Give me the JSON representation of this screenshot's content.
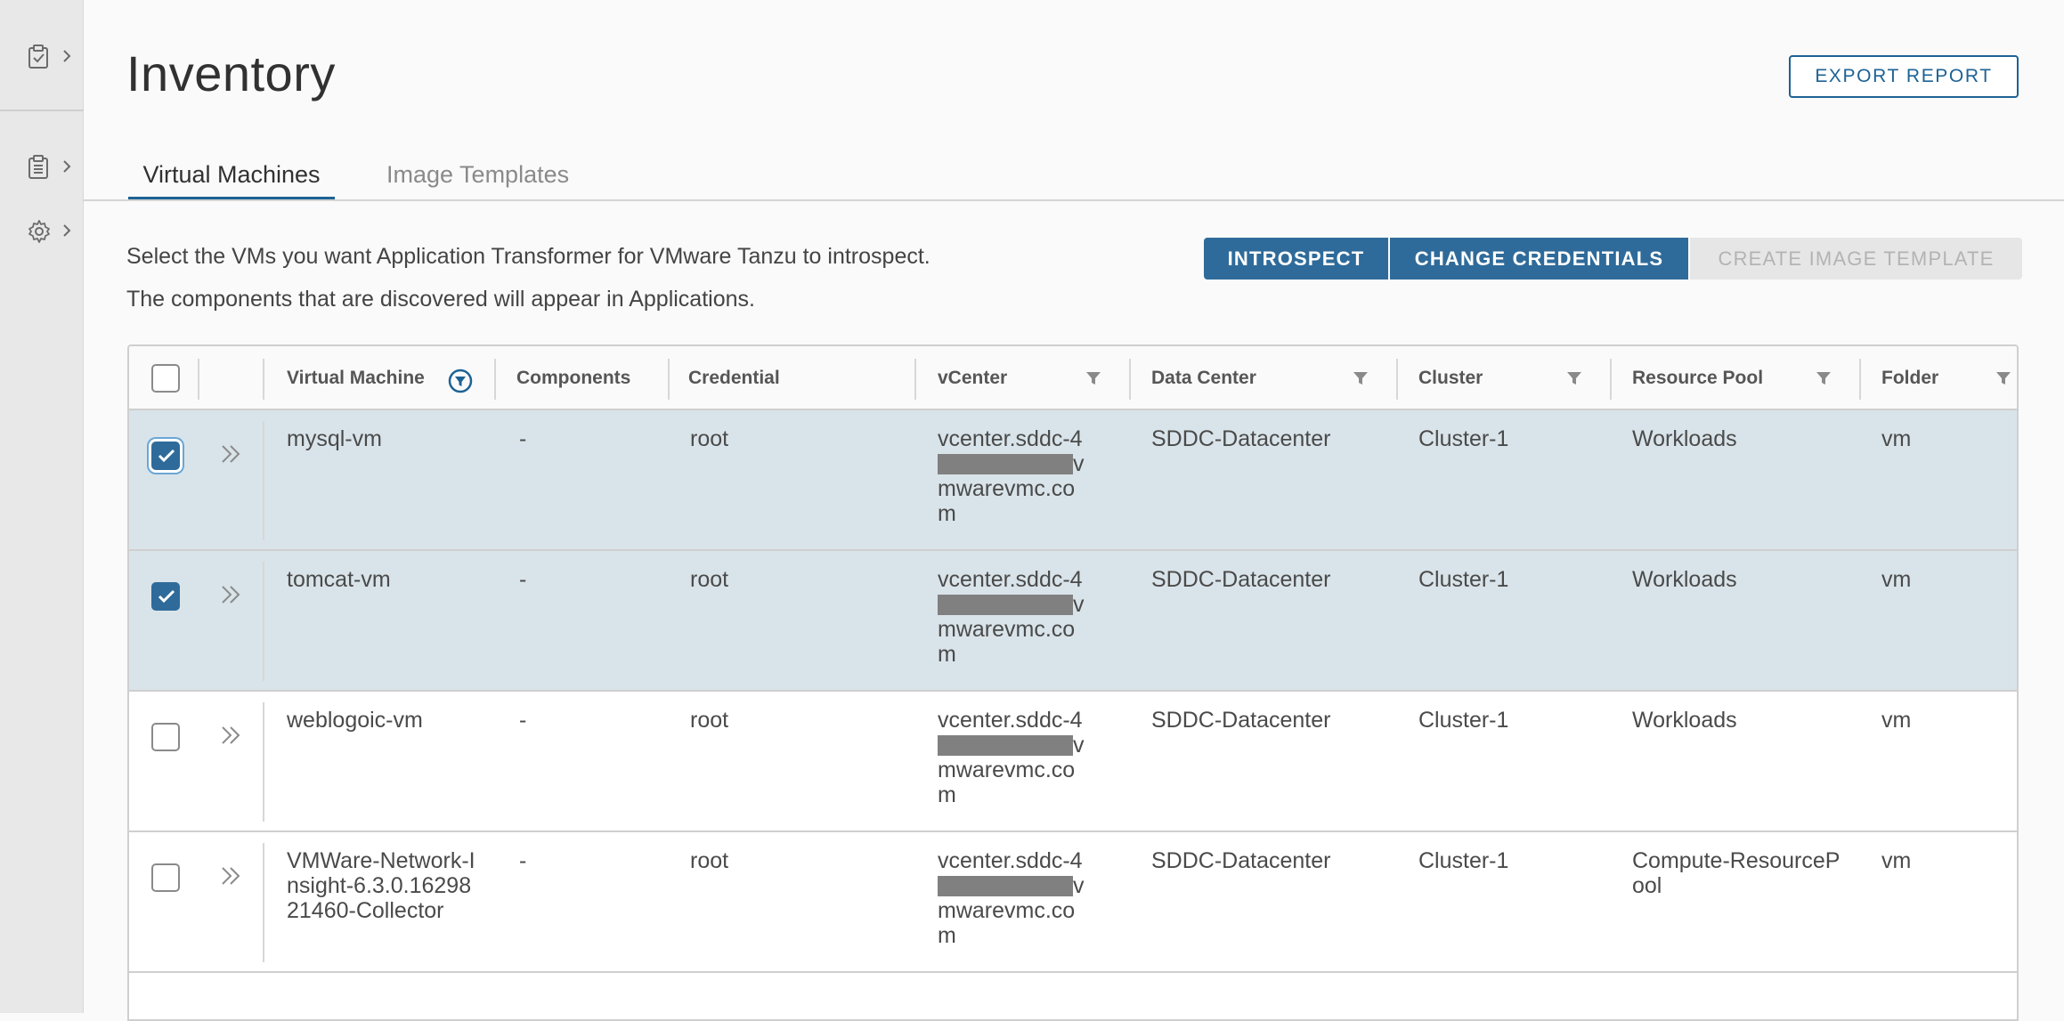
{
  "sidenav": {
    "items": [
      {
        "icon": "clipboard-check-icon"
      },
      {
        "icon": "clipboard-list-icon"
      },
      {
        "icon": "gear-icon"
      }
    ]
  },
  "header": {
    "title": "Inventory",
    "export_label": "EXPORT REPORT"
  },
  "tabs": [
    {
      "label": "Virtual Machines",
      "active": true
    },
    {
      "label": "Image Templates",
      "active": false
    }
  ],
  "description": {
    "line1": "Select the VMs you want Application Transformer for VMware Tanzu to introspect.",
    "line2": "The components that are discovered will appear in Applications."
  },
  "actions": {
    "introspect": "INTROSPECT",
    "change_credentials": "CHANGE CREDENTIALS",
    "create_image_template": "CREATE IMAGE TEMPLATE"
  },
  "table": {
    "columns": [
      "Virtual Machine",
      "Components",
      "Credential",
      "vCenter",
      "Data Center",
      "Cluster",
      "Resource Pool",
      "Folder"
    ],
    "rows": [
      {
        "selected": true,
        "vm": "mysql-vm",
        "components": "-",
        "credential": "root",
        "vc1": "vcenter.sddc-4",
        "vc2": "v",
        "vc3": "mwarevmc.co",
        "vc4": "m",
        "datacenter": "SDDC-Datacenter",
        "cluster": "Cluster-1",
        "pool": "Workloads",
        "folder": "vm"
      },
      {
        "selected": true,
        "vm": "tomcat-vm",
        "components": "-",
        "credential": "root",
        "vc1": "vcenter.sddc-4",
        "vc2": "v",
        "vc3": "mwarevmc.co",
        "vc4": "m",
        "datacenter": "SDDC-Datacenter",
        "cluster": "Cluster-1",
        "pool": "Workloads",
        "folder": "vm"
      },
      {
        "selected": false,
        "vm": "weblogoic-vm",
        "components": "-",
        "credential": "root",
        "vc1": "vcenter.sddc-4",
        "vc2": "v",
        "vc3": "mwarevmc.co",
        "vc4": "m",
        "datacenter": "SDDC-Datacenter",
        "cluster": "Cluster-1",
        "pool": "Workloads",
        "folder": "vm"
      },
      {
        "selected": false,
        "vm": "VMWare-Network-Insight-6.3.0.1629821460-Collector",
        "components": "-",
        "credential": "root",
        "vc1": "vcenter.sddc-4",
        "vc2": "v",
        "vc3": "mwarevmc.co",
        "vc4": "m",
        "datacenter": "SDDC-Datacenter",
        "cluster": "Cluster-1",
        "pool": "Compute-ResourcePool",
        "folder": "vm"
      }
    ]
  },
  "colors": {
    "accent": "#1d6294",
    "button": "#2f6b9a",
    "selected_row": "#d9e4ea"
  }
}
